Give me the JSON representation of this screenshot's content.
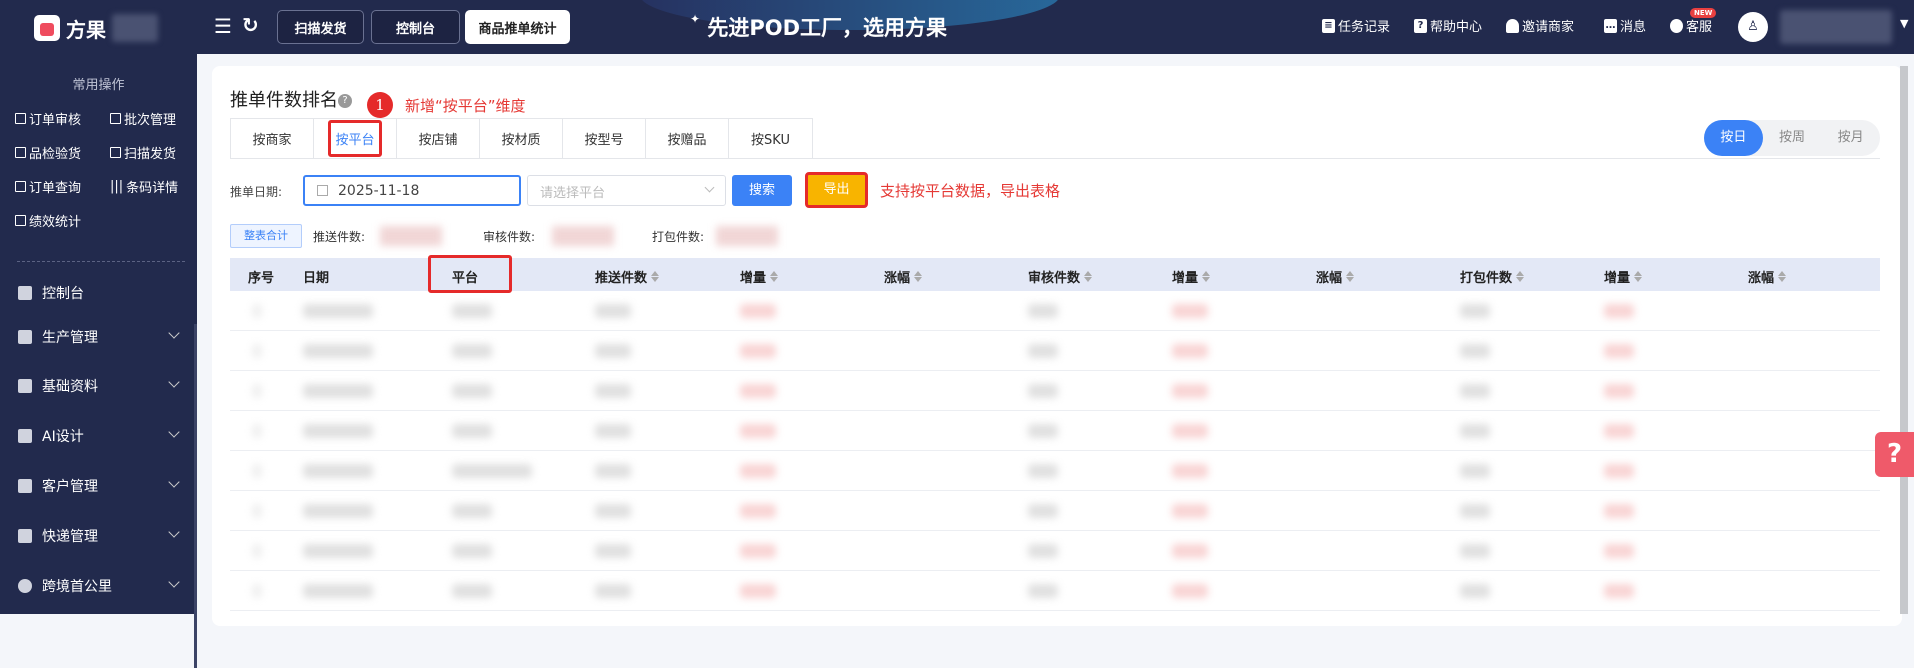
{
  "header": {
    "brand": "方果",
    "nav_buttons": [
      {
        "label": "扫描发货",
        "active": false
      },
      {
        "label": "控制台",
        "active": false
      },
      {
        "label": "商品推单统计",
        "active": true
      }
    ],
    "slogan": "先进POD工厂，选用方果",
    "right_links": [
      "任务记录",
      "帮助中心",
      "邀请商家",
      "消息",
      "客服"
    ],
    "new_badge": "NEW"
  },
  "sidebar": {
    "caption": "常用操作",
    "quick": [
      "订单审核",
      "批次管理",
      "品检验货",
      "扫描发货",
      "订单查询",
      "条码详情",
      "绩效统计"
    ],
    "menu": [
      "控制台",
      "生产管理",
      "基础资料",
      "AI设计",
      "客户管理",
      "快递管理",
      "跨境首公里"
    ]
  },
  "page": {
    "title": "推单件数排名",
    "annotation_badge": "1",
    "annotation_tabs": "新增“按平台”维度",
    "tabs": [
      "按商家",
      "按平台",
      "按店铺",
      "按材质",
      "按型号",
      "按赠品",
      "按SKU"
    ],
    "active_tab": 1,
    "period": [
      "按日",
      "按周",
      "按月"
    ],
    "active_period": 0
  },
  "filter": {
    "date_label": "推单日期:",
    "date_value": "2025-11-18",
    "platform_placeholder": "请选择平台",
    "search": "搜索",
    "export": "导出",
    "annotation_export": "支持按平台数据，导出表格"
  },
  "summary": {
    "tag": "整表合计",
    "push": "推送件数:",
    "review": "审核件数:",
    "pack": "打包件数:"
  },
  "table": {
    "columns": [
      "序号",
      "日期",
      "平台",
      "推送件数",
      "增量",
      "涨幅",
      "审核件数",
      "增量",
      "涨幅",
      "打包件数",
      "增量",
      "涨幅"
    ],
    "sortable": [
      false,
      false,
      false,
      true,
      true,
      true,
      true,
      true,
      true,
      true,
      true,
      true
    ]
  },
  "colors": {
    "header_bg": "#222a4d",
    "accent": "#3b82f6",
    "annotation": "#e52a2a",
    "export": "#f8b400"
  }
}
